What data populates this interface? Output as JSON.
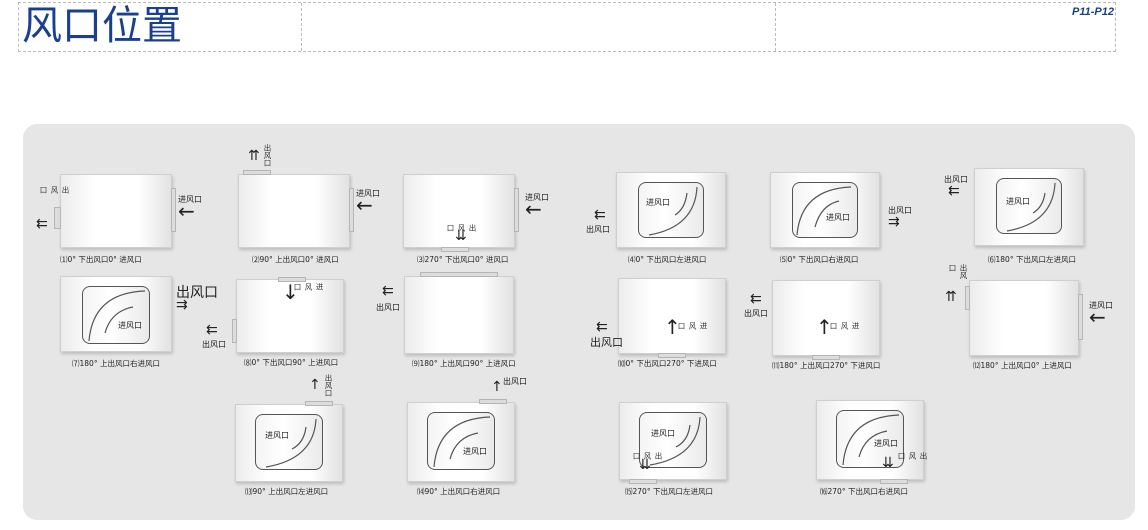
{
  "header": {
    "title": "风口位置",
    "page_ref": "P11-P12"
  },
  "labels": {
    "inlet": "进风口",
    "outlet": "出风口"
  },
  "captions": [
    "⑴0° 下出风口0° 进风口",
    "⑵90° 上出风口0° 进风口",
    "⑶270° 下出风口0° 进风口",
    "⑷0° 下出风口左进风口",
    "⑸0° 下出风口右进风口",
    "⑹180° 下出风口左进风口",
    "⑺180° 上出风口右进风口",
    "⑻0° 下出风口90° 上进风口",
    "⑼180° 上出风口90° 上进风口",
    "⑽0° 下出风口270° 下进风口",
    "⑾180° 上出风口270° 下进风口",
    "⑿180° 上出风口0° 上进风口",
    "⒀90° 上出风口左进风口",
    "⒁90° 上出风口右进风口",
    "⒂270° 下出风口左进风口",
    "⒃270° 下出风口右进风口"
  ],
  "arrows": {
    "left": "←",
    "double_left": "⇇",
    "double_right": "⇉",
    "up": "↑",
    "down": "↓",
    "double_up": "⇈",
    "double_down": "⇊"
  }
}
